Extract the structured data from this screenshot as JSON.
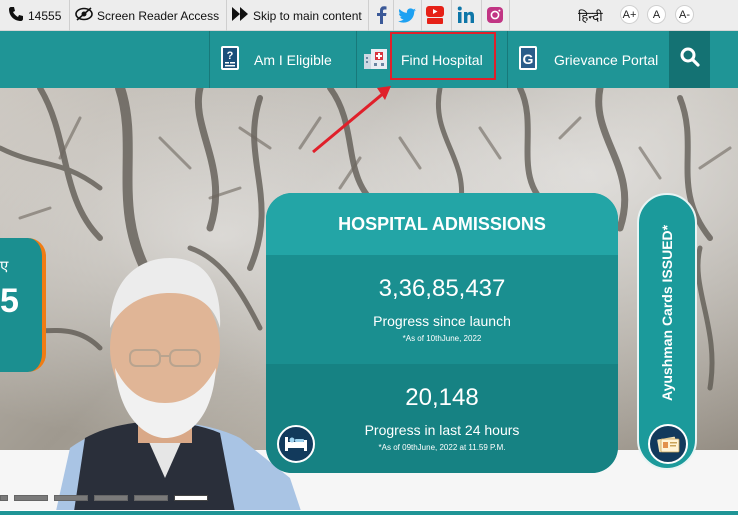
{
  "topbar": {
    "helpline": "14555",
    "screen_reader": "Screen Reader Access",
    "skip_to_main": "Skip to main content",
    "language": "हिन्दी",
    "font_increase": "A+",
    "font_normal": "A",
    "font_decrease": "A-"
  },
  "nav": {
    "eligible": "Am I Eligible",
    "find_hospital": "Find Hospital",
    "grievance": "Grievance Portal"
  },
  "hero": {
    "left_card_text1": "ए",
    "left_card_text2": "5"
  },
  "stats": {
    "title": "HOSPITAL ADMISSIONS",
    "total_value": "3,36,85,437",
    "total_label": "Progress since launch",
    "total_note": "*As of 10thJune, 2022",
    "daily_value": "20,148",
    "daily_label": "Progress in last 24 hours",
    "daily_note": "*As of 09thJune, 2022 at 11.59 P.M."
  },
  "cards_panel": {
    "label": "Ayushman Cards ISSUED*"
  },
  "carousel": {
    "slide_count": 6,
    "active_index": 5
  },
  "colors": {
    "brand_teal": "#1f9596",
    "dark_teal": "#147273",
    "highlight_red": "#e0202a",
    "accent_orange": "#f07c14"
  }
}
